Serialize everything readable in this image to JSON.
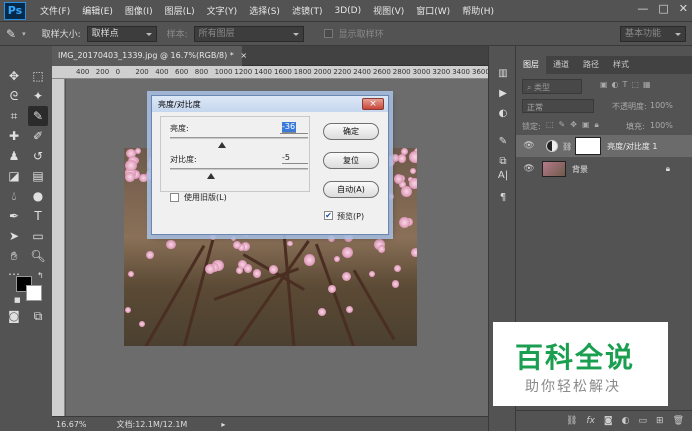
{
  "app": {
    "logo": "Ps"
  },
  "menu": [
    "文件(F)",
    "编辑(E)",
    "图像(I)",
    "图层(L)",
    "文字(Y)",
    "选择(S)",
    "滤镜(T)",
    "3D(D)",
    "视图(V)",
    "窗口(W)",
    "帮助(H)"
  ],
  "options": {
    "sample_size_label": "取样大小:",
    "sample_size_value": "取样点",
    "sample_label": "样本:",
    "sample_value": "所有图层",
    "show_ring_label": "显示取样环",
    "workspace": "基本功能"
  },
  "document": {
    "tab_title": "IMG_20170403_1339.jpg @ 16.7%(RGB/8) *",
    "close_glyph": "×",
    "zoom": "16.67%",
    "doc_info": "文档:12.1M/12.1M",
    "ruler_ticks": [
      "400",
      "200",
      "0",
      "200",
      "400",
      "600",
      "800",
      "1000",
      "1200",
      "1400",
      "1600",
      "1800",
      "2000",
      "2200",
      "2400",
      "2600",
      "2800",
      "3000",
      "3200",
      "3400",
      "3600",
      "380"
    ]
  },
  "dialog": {
    "title": "亮度/对比度",
    "close_glyph": "×",
    "brightness_label": "亮度:",
    "brightness_value": "-36",
    "brightness_level": -36,
    "contrast_label": "对比度:",
    "contrast_value": "-5",
    "contrast_level": -5,
    "legacy_label": "使用旧版(L)",
    "legacy_checked": false,
    "ok_label": "确定",
    "reset_label": "复位",
    "auto_label": "自动(A)",
    "preview_label": "预览(P)",
    "preview_checked": true
  },
  "layers_panel": {
    "tabs": [
      "图层",
      "通道",
      "路径",
      "样式"
    ],
    "kind_filter": "类型",
    "blend_mode": "正常",
    "opacity_label": "不透明度:",
    "opacity_value": "100%",
    "lock_label": "锁定:",
    "fill_label": "填充:",
    "fill_value": "100%",
    "layers": [
      {
        "name": "亮度/对比度 1",
        "selected": true
      },
      {
        "name": "背景",
        "selected": false
      }
    ]
  },
  "watermark": {
    "title": "百科全说",
    "subtitle": "助你轻松解决"
  },
  "colors": {
    "accent": "#3b7bd8",
    "watermark_green": "#1a9e50",
    "panel_bg": "#535353"
  }
}
